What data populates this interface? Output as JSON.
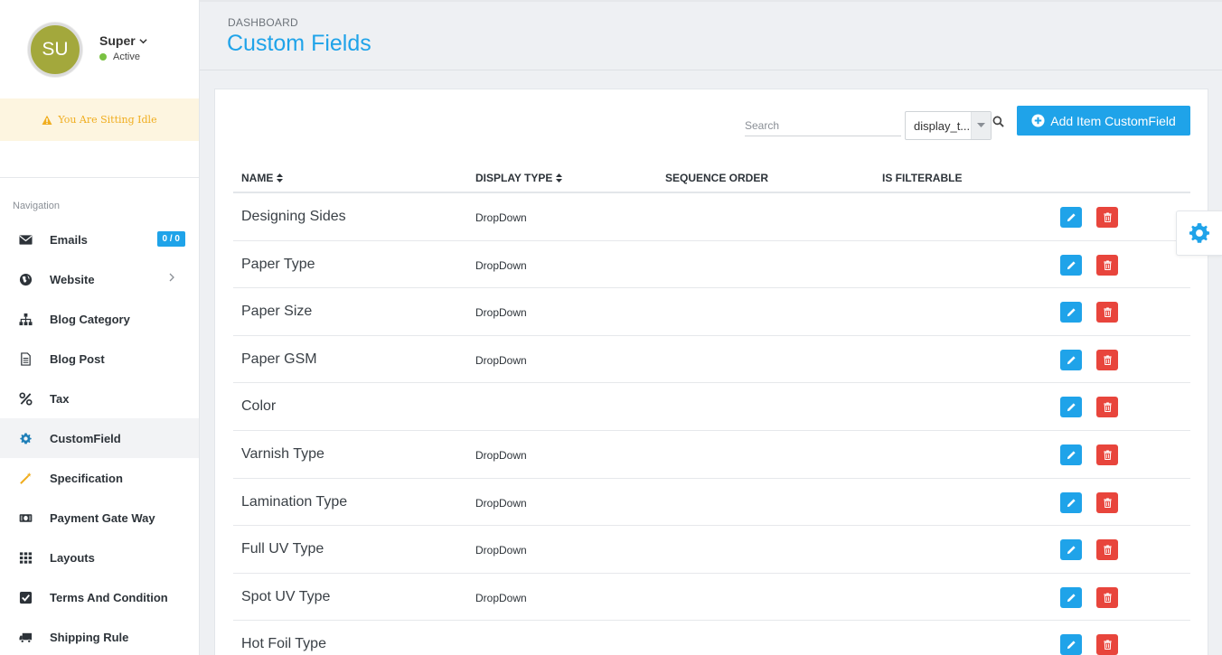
{
  "user": {
    "initials": "SU",
    "name": "Super",
    "status": "Active"
  },
  "idle_banner": "You Are Sitting Idle",
  "nav_heading": "Navigation",
  "nav": {
    "items": [
      {
        "label": "Emails",
        "icon": "envelope-icon",
        "badge": "0 / 0"
      },
      {
        "label": "Website",
        "icon": "globe-icon"
      },
      {
        "label": "Blog Category",
        "icon": "sitemap-icon"
      },
      {
        "label": "Blog Post",
        "icon": "file-text-icon"
      },
      {
        "label": "Tax",
        "icon": "percent-icon"
      },
      {
        "label": "CustomField",
        "icon": "gear-icon",
        "active": true
      },
      {
        "label": "Specification",
        "icon": "magic-wand-icon"
      },
      {
        "label": "Payment Gate Way",
        "icon": "money-icon"
      },
      {
        "label": "Layouts",
        "icon": "grid-icon"
      },
      {
        "label": "Terms And Condition",
        "icon": "check-square-icon"
      },
      {
        "label": "Shipping Rule",
        "icon": "truck-icon"
      }
    ]
  },
  "header": {
    "breadcrumb": "DASHBOARD",
    "title": "Custom Fields"
  },
  "toolbar": {
    "search_placeholder": "Search",
    "search_value": "",
    "select_value": "display_t...",
    "add_button_label": "Add Item CustomField"
  },
  "table": {
    "columns": [
      "NAME",
      "DISPLAY TYPE",
      "SEQUENCE ORDER",
      "IS FILTERABLE"
    ],
    "rows": [
      {
        "name": "Designing Sides",
        "display_type": "DropDown",
        "sequence_order": "",
        "is_filterable": ""
      },
      {
        "name": "Paper Type",
        "display_type": "DropDown",
        "sequence_order": "",
        "is_filterable": ""
      },
      {
        "name": "Paper Size",
        "display_type": "DropDown",
        "sequence_order": "",
        "is_filterable": ""
      },
      {
        "name": "Paper GSM",
        "display_type": "DropDown",
        "sequence_order": "",
        "is_filterable": ""
      },
      {
        "name": "Color",
        "display_type": "",
        "sequence_order": "",
        "is_filterable": ""
      },
      {
        "name": "Varnish Type",
        "display_type": "DropDown",
        "sequence_order": "",
        "is_filterable": ""
      },
      {
        "name": "Lamination Type",
        "display_type": "DropDown",
        "sequence_order": "",
        "is_filterable": ""
      },
      {
        "name": "Full UV Type",
        "display_type": "DropDown",
        "sequence_order": "",
        "is_filterable": ""
      },
      {
        "name": "Spot UV Type",
        "display_type": "DropDown",
        "sequence_order": "",
        "is_filterable": ""
      },
      {
        "name": "Hot Foil Type",
        "display_type": "",
        "sequence_order": "",
        "is_filterable": ""
      }
    ]
  },
  "colors": {
    "accent": "#1fa3e9",
    "danger": "#e8453c",
    "avatar": "#a3a83c",
    "status_active": "#7ac142",
    "idle_text": "#f0ad1e"
  }
}
